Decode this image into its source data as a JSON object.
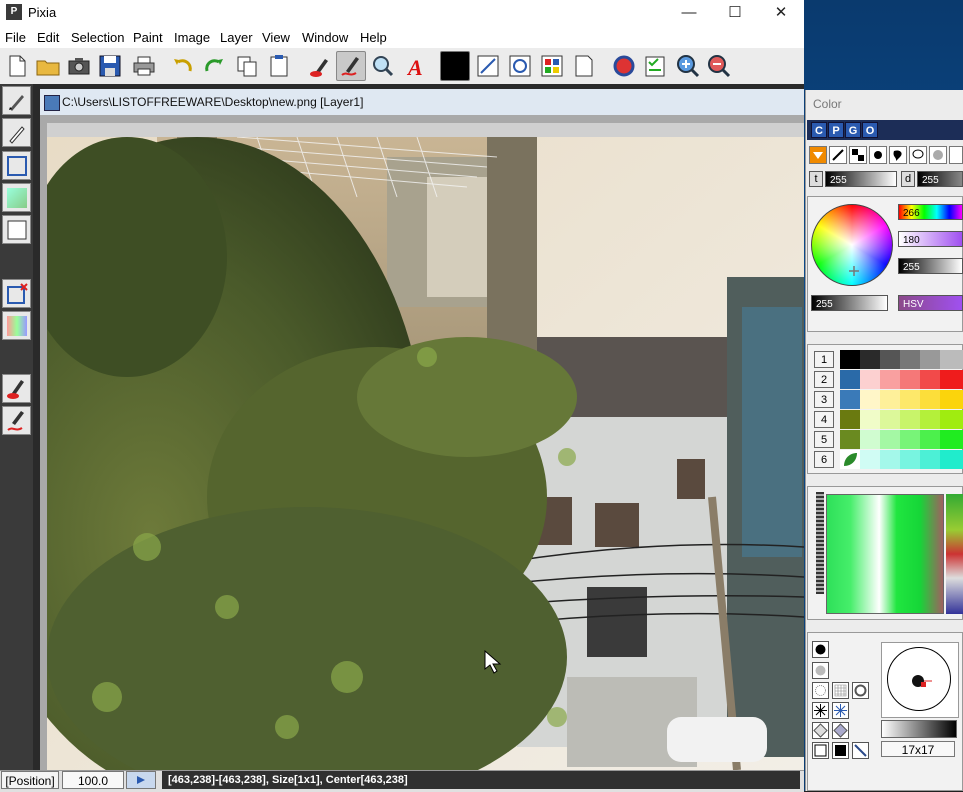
{
  "app": {
    "title": "Pixia",
    "icon_label": "P"
  },
  "window_controls": {
    "minimize": "—",
    "maximize": "☐",
    "close": "✕"
  },
  "menu": [
    "File",
    "Edit",
    "Selection",
    "Paint",
    "Image",
    "Layer",
    "View",
    "Window",
    "Help"
  ],
  "toolbar": {
    "icons": [
      "new-file-icon",
      "open-folder-icon",
      "camera-icon",
      "save-disk-icon",
      "printer-icon",
      "undo-icon",
      "redo-icon",
      "copy-icon",
      "clipboard-icon",
      "brush-red-icon",
      "brush-active-icon",
      "magnifier-icon",
      "text-a-icon",
      "color-swatch-black",
      "scale-icon",
      "transform-icon",
      "palette-icon",
      "paste-icon",
      "globe-icon",
      "checklist-icon",
      "zoom-in-icon",
      "zoom-out-icon"
    ]
  },
  "document": {
    "title": "C:\\Users\\LISTOFFREEWARE\\Desktop\\new.png [Layer1]"
  },
  "status": {
    "position_label": "[Position]",
    "zoom": "100.0",
    "info": "[463,238]-[463,238], Size[1x1], Center[463,238]"
  },
  "color_panel": {
    "title": "Color",
    "tabs": [
      "C",
      "P",
      "G",
      "O"
    ],
    "thickness_label": "t",
    "thickness_value": "255",
    "density_label": "d",
    "density_value": "255",
    "hue_value": "266",
    "sat_value": "180",
    "val_value": "255",
    "alpha_value": "255",
    "mode_label": "HSV",
    "palette_rows": [
      "1",
      "2",
      "3",
      "4",
      "5",
      "6"
    ],
    "brush_size": "17x17"
  },
  "colors": {
    "accent_blue": "#2a5ab0",
    "desktop": "#0c4c8e",
    "status_dark": "#303030"
  }
}
